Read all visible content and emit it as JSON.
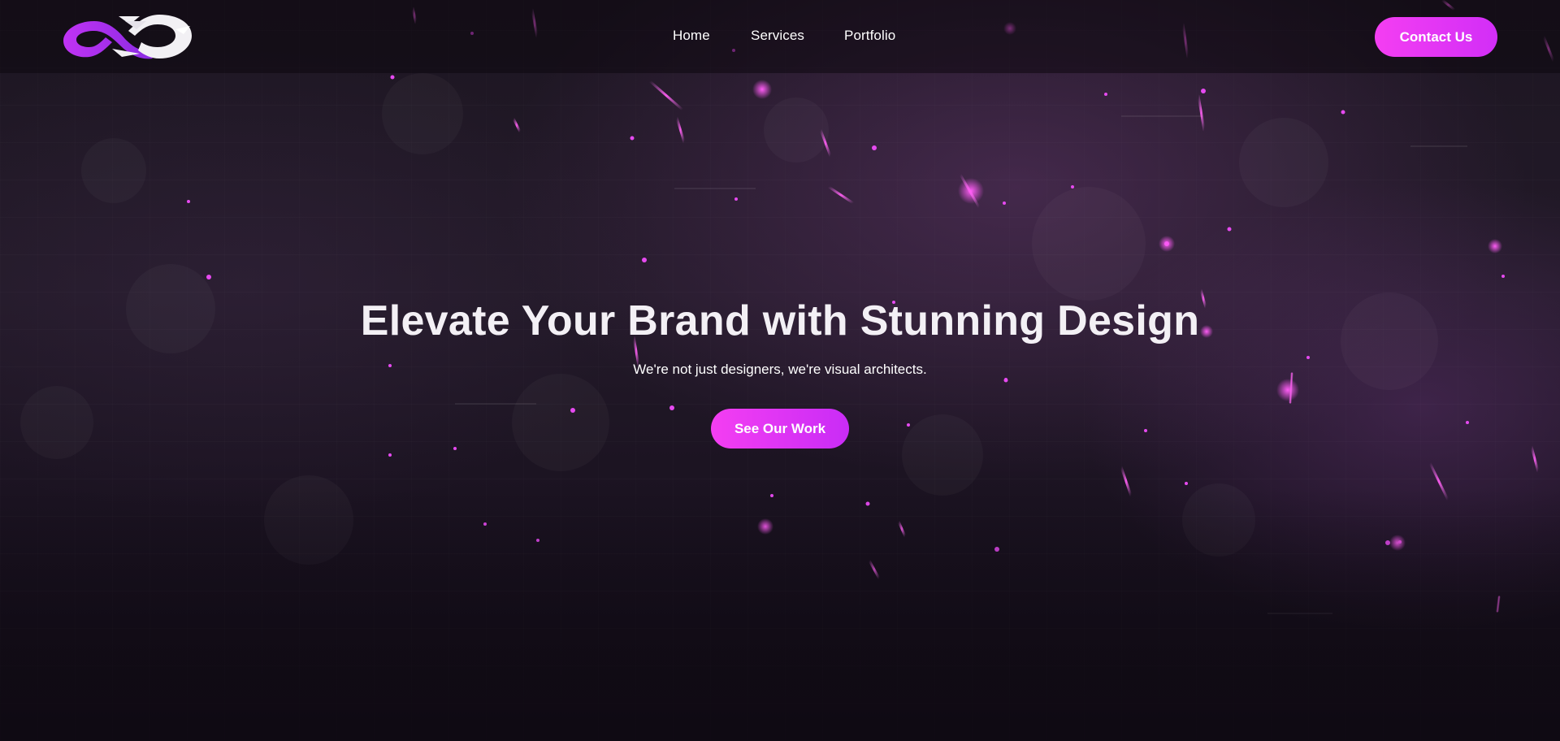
{
  "header": {
    "logo_icon": "infinity-logo-icon",
    "nav": [
      {
        "label": "Home"
      },
      {
        "label": "Services"
      },
      {
        "label": "Portfolio"
      }
    ],
    "contact_label": "Contact Us"
  },
  "hero": {
    "title": "Elevate Your Brand with Stunning Design",
    "subtitle": "We're not just designers, we're visual architects.",
    "cta_label": "See Our Work"
  },
  "colors": {
    "accent": "#f43ef2",
    "accent_secondary": "#c92cf6",
    "background": "#1d1622",
    "text": "#ffffff"
  }
}
